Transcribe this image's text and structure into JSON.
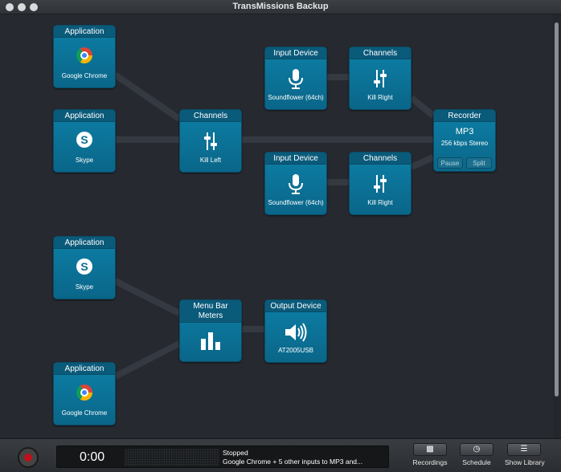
{
  "window": {
    "title": "TransMissions Backup"
  },
  "nodes": {
    "app_chrome_1": {
      "header": "Application",
      "label": "Google Chrome",
      "icon": "chrome-icon"
    },
    "app_skype_1": {
      "header": "Application",
      "label": "Skype",
      "icon": "skype-icon"
    },
    "channels_kill_left": {
      "header": "Channels",
      "label": "Kill Left",
      "icon": "sliders-icon"
    },
    "input_device_1": {
      "header": "Input Device",
      "label": "Soundflower (64ch)",
      "icon": "microphone-icon"
    },
    "channels_kill_right_1": {
      "header": "Channels",
      "label": "Kill Right",
      "icon": "sliders-icon"
    },
    "input_device_2": {
      "header": "Input Device",
      "label": "Soundflower (64ch)",
      "icon": "microphone-icon"
    },
    "channels_kill_right_2": {
      "header": "Channels",
      "label": "Kill Right",
      "icon": "sliders-icon"
    },
    "recorder": {
      "header": "Recorder",
      "format": "MP3",
      "quality": "256 kbps Stereo",
      "pause_label": "Pause",
      "split_label": "Split"
    },
    "app_skype_2": {
      "header": "Application",
      "label": "Skype",
      "icon": "skype-icon"
    },
    "menu_bar_meters": {
      "header_line1": "Menu Bar",
      "header_line2": "Meters",
      "icon": "bar-meters-icon"
    },
    "output_device": {
      "header": "Output Device",
      "label": "AT2005USB",
      "icon": "speaker-icon"
    },
    "app_chrome_2": {
      "header": "Application",
      "label": "Google Chrome",
      "icon": "chrome-icon"
    }
  },
  "toolbar": {
    "time": "0:00",
    "status_title": "Stopped",
    "status_detail": "Google Chrome + 5 other inputs to MP3 and...",
    "recordings_label": "Recordings",
    "schedule_label": "Schedule",
    "library_label": "Show Library"
  },
  "colors": {
    "node": "#0a6d92",
    "canvas": "#262a30",
    "record": "#c0101a"
  }
}
